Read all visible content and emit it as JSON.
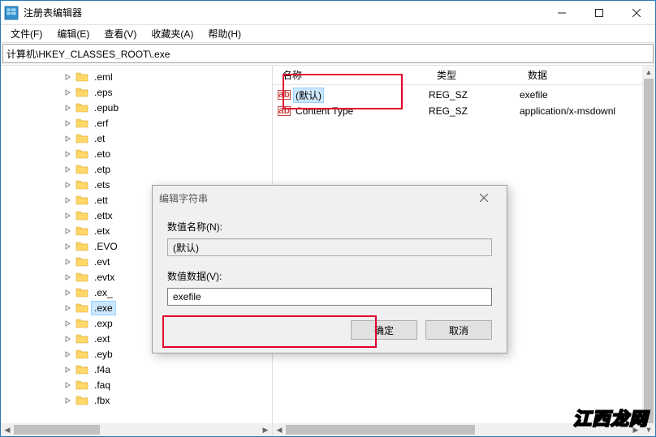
{
  "window": {
    "title": "注册表编辑器",
    "address": "计算机\\HKEY_CLASSES_ROOT\\.exe"
  },
  "menu": {
    "file": "文件(F)",
    "edit": "编辑(E)",
    "view": "查看(V)",
    "favorites": "收藏夹(A)",
    "help": "帮助(H)"
  },
  "tree": {
    "items": [
      {
        "indent": 4,
        "label": ".eml",
        "selected": false
      },
      {
        "indent": 4,
        "label": ".eps",
        "selected": false
      },
      {
        "indent": 4,
        "label": ".epub",
        "selected": false
      },
      {
        "indent": 4,
        "label": ".erf",
        "selected": false
      },
      {
        "indent": 4,
        "label": ".et",
        "selected": false
      },
      {
        "indent": 4,
        "label": ".eto",
        "selected": false
      },
      {
        "indent": 4,
        "label": ".etp",
        "selected": false
      },
      {
        "indent": 4,
        "label": ".ets",
        "selected": false
      },
      {
        "indent": 4,
        "label": ".ett",
        "selected": false
      },
      {
        "indent": 4,
        "label": ".ettx",
        "selected": false
      },
      {
        "indent": 4,
        "label": ".etx",
        "selected": false
      },
      {
        "indent": 4,
        "label": ".EVO",
        "selected": false
      },
      {
        "indent": 4,
        "label": ".evt",
        "selected": false
      },
      {
        "indent": 4,
        "label": ".evtx",
        "selected": false
      },
      {
        "indent": 4,
        "label": ".ex_",
        "selected": false
      },
      {
        "indent": 4,
        "label": ".exe",
        "selected": true
      },
      {
        "indent": 4,
        "label": ".exp",
        "selected": false
      },
      {
        "indent": 4,
        "label": ".ext",
        "selected": false
      },
      {
        "indent": 4,
        "label": ".eyb",
        "selected": false
      },
      {
        "indent": 4,
        "label": ".f4a",
        "selected": false
      },
      {
        "indent": 4,
        "label": ".faq",
        "selected": false
      },
      {
        "indent": 4,
        "label": ".fbx",
        "selected": false
      }
    ]
  },
  "list": {
    "headers": {
      "name": "名称",
      "type": "类型",
      "data": "数据"
    },
    "rows": [
      {
        "name": "(默认)",
        "type": "REG_SZ",
        "data": "exefile",
        "selected": true
      },
      {
        "name": "Content Type",
        "type": "REG_SZ",
        "data": "application/x-msdownl",
        "selected": false
      }
    ]
  },
  "dialog": {
    "title": "编辑字符串",
    "name_label": "数值名称(N):",
    "name_value": "(默认)",
    "data_label": "数值数据(V):",
    "data_value": "exefile",
    "ok": "确定",
    "cancel": "取消"
  },
  "watermark": "江西龙网"
}
